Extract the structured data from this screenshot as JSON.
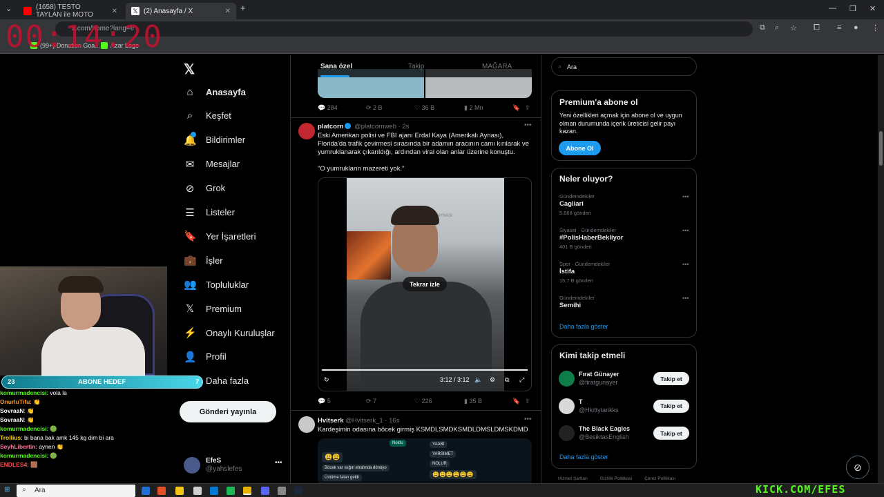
{
  "browser": {
    "tabs": [
      {
        "title": "(1658) TESTO TAYLAN ile MOTO"
      },
      {
        "title": "(2) Anasayfa / X"
      }
    ],
    "url": "x.com/home?lang=tr",
    "bookmarks": [
      "(99+) Donation Goa...",
      "Azar Logo"
    ]
  },
  "stream_timer": "00:14:20",
  "nav": {
    "items": [
      {
        "label": "Anasayfa",
        "icon": "home-icon"
      },
      {
        "label": "Keşfet",
        "icon": "search-icon"
      },
      {
        "label": "Bildirimler",
        "icon": "bell-icon"
      },
      {
        "label": "Mesajlar",
        "icon": "mail-icon"
      },
      {
        "label": "Grok",
        "icon": "grok-icon"
      },
      {
        "label": "Listeler",
        "icon": "list-icon"
      },
      {
        "label": "Yer İşaretleri",
        "icon": "bookmark-icon"
      },
      {
        "label": "İşler",
        "icon": "briefcase-icon"
      },
      {
        "label": "Topluluklar",
        "icon": "people-icon"
      },
      {
        "label": "Premium",
        "icon": "x-logo-icon"
      },
      {
        "label": "Onaylı Kuruluşlar",
        "icon": "bolt-icon"
      },
      {
        "label": "Profil",
        "icon": "person-icon"
      },
      {
        "label": "Daha fazla",
        "icon": "more-icon"
      }
    ],
    "post_button": "Gönderi yayınla",
    "account": {
      "name": "EfeS",
      "handle": "@yahslefes"
    }
  },
  "timeline": {
    "tabs": [
      "Sana özel",
      "Takip",
      "MAĞARA"
    ],
    "prev_actions": {
      "replies": "284",
      "reposts": "2 B",
      "likes": "36 B",
      "views": "2 Mn"
    },
    "tweet1": {
      "name": "platcorn",
      "handle": "@platcornweb",
      "time": "2s",
      "text": "Eski Amerikan polisi ve FBI ajanı Erdal Kaya (Amerikalı Aynası), Florida'da trafik çevirmesi sırasında bir adamın aracının camı kırılarak ve yumruklanarak çıkarıldığı, ardından viral olan anlar üzerine konuştu.",
      "quote": "\"O yumrukların mazereti yok.\"",
      "video": {
        "replay_label": "Tekrar izle",
        "time": "3:12 / 3:12",
        "sign": "AMERİKALI AYNASI",
        "progress": 1.0
      },
      "actions": {
        "replies": "5",
        "reposts": "7",
        "likes": "226",
        "views": "35 B"
      }
    },
    "tweet2": {
      "name": "Hvitserk",
      "handle": "@Hvitserk_1",
      "time": "16s",
      "text": "Kardeşimin odasına böcek girmiş KSMDLSMDKSMDLDMSLDMSKDMD",
      "chat": [
        "Noldu",
        "😩😩",
        "Böcek var ısığın etrafında dönüyo",
        "Üstüme falan geldi",
        "YAABI",
        "YARSIMET",
        "NOLUR",
        "😩😩😩😩😩😩"
      ]
    }
  },
  "right": {
    "search_placeholder": "Ara",
    "premium": {
      "title": "Premium'a abone ol",
      "desc": "Yeni özellikleri açmak için abone ol ve uygun olman durumunda içerik üreticisi gelir payı kazan.",
      "button": "Abone Ol"
    },
    "trends": {
      "title": "Neler oluyor?",
      "items": [
        {
          "cat": "Gündemdekiler",
          "name": "Cagliari",
          "count": "5.866 gönderi"
        },
        {
          "cat": "Siyaset · Gündemdekiler",
          "name": "#PolisHaberBekliyor",
          "count": "401 B gönderi"
        },
        {
          "cat": "Spor · Gündemdekiler",
          "name": "İstifa",
          "count": "15,7 B gönderi"
        },
        {
          "cat": "Gündemdekiler",
          "name": "Semihi",
          "count": ""
        }
      ],
      "more": "Daha fazla göster"
    },
    "who_to_follow": {
      "title": "Kimi takip etmeli",
      "items": [
        {
          "name": "Fırat Günayer",
          "handle": "@firatgunayer",
          "button": "Takip et"
        },
        {
          "name": "T",
          "handle": "@Hkittytarikks",
          "button": "Takip et"
        },
        {
          "name": "The Black Eagles",
          "handle": "@BesiktasEnglish",
          "button": "Takip et"
        }
      ],
      "more": "Daha fazla göster"
    },
    "footer": [
      "Hizmet Şartları",
      "Gizlilik Politikası",
      "Çerez Politikası"
    ]
  },
  "overlay": {
    "goal": {
      "left": "23",
      "label": "ABONE HEDEF",
      "right": "7"
    },
    "chat": [
      {
        "user": "komurmadencisi",
        "msg": ": vola la"
      },
      {
        "user": "OnurluTifu",
        "msg": ": 👏"
      },
      {
        "user": "SovraaN",
        "msg": ": 👏"
      },
      {
        "user": "SovraaN",
        "msg": ": 👏"
      },
      {
        "user": "komurmadencisi",
        "msg": ": 🟢"
      },
      {
        "user": "Trollius",
        "msg": ": bi bana bak amk 145 kg dim bi ara"
      },
      {
        "user": "SeyhLibertin",
        "msg": ": aynen 👏"
      },
      {
        "user": "komurmadencisi",
        "msg": ": 🟢"
      },
      {
        "user": "ENDLES4",
        "msg": ": 🟫"
      }
    ],
    "kick": "KICK.COM/EFES"
  },
  "taskbar": {
    "search_placeholder": "Ara"
  },
  "colors": {
    "accent": "#1d9bf0",
    "kick_green": "#53fc18",
    "timer_red": "#c8102e"
  }
}
